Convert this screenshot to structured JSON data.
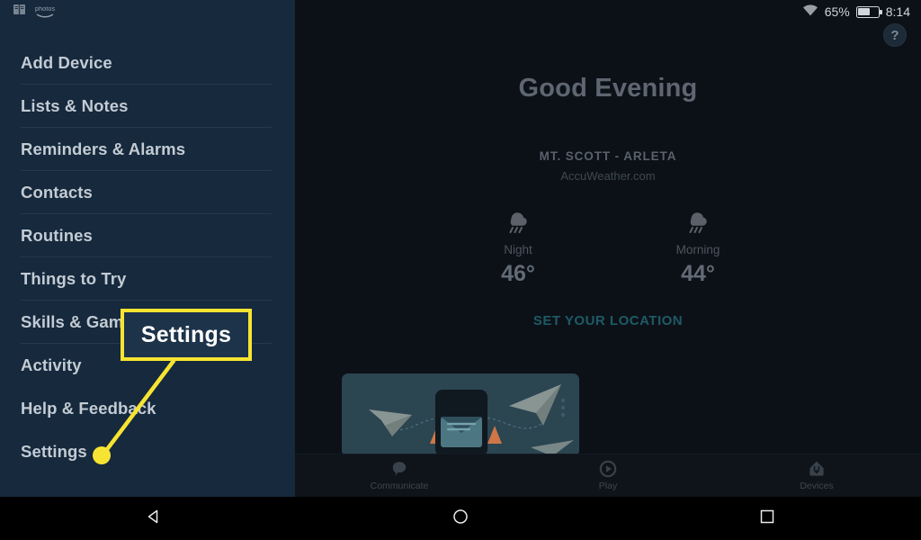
{
  "status_bar": {
    "notification_icons": [
      {
        "name": "book-icon",
        "label": "book"
      },
      {
        "name": "amazon-photos-icon",
        "label": "photos"
      }
    ],
    "wifi_icon": "wifi-icon",
    "battery_percent": "65%",
    "battery_icon": "battery-icon",
    "time": "8:14"
  },
  "sidebar": {
    "items": [
      {
        "label": "Add Device",
        "name": "sidebar-item-add-device",
        "divider": true
      },
      {
        "label": "Lists & Notes",
        "name": "sidebar-item-lists-notes",
        "divider": true
      },
      {
        "label": "Reminders & Alarms",
        "name": "sidebar-item-reminders-alarms",
        "divider": true
      },
      {
        "label": "Contacts",
        "name": "sidebar-item-contacts",
        "divider": true
      },
      {
        "label": "Routines",
        "name": "sidebar-item-routines",
        "divider": true
      },
      {
        "label": "Things to Try",
        "name": "sidebar-item-things-to-try",
        "divider": true
      },
      {
        "label": "Skills & Games",
        "name": "sidebar-item-skills-games",
        "divider": true
      },
      {
        "label": "Activity",
        "name": "sidebar-item-activity",
        "divider": false
      },
      {
        "label": "Help & Feedback",
        "name": "sidebar-item-help-feedback",
        "divider": false
      },
      {
        "label": "Settings",
        "name": "sidebar-item-settings",
        "divider": false
      }
    ]
  },
  "main": {
    "help_button": "?",
    "greeting": "Good Evening",
    "weather": {
      "city": "MT. SCOTT - ARLETA",
      "attribution": "AccuWeather.com",
      "forecasts": [
        {
          "when": "Night",
          "temp": "46°",
          "icon": "rain-cloud-icon"
        },
        {
          "when": "Morning",
          "temp": "44°",
          "icon": "rain-cloud-icon"
        }
      ],
      "set_location_label": "SET YOUR LOCATION"
    }
  },
  "tab_bar": {
    "tabs": [
      {
        "label": "Communicate",
        "name": "tab-communicate",
        "icon": "speech-bubble-icon"
      },
      {
        "label": "Play",
        "name": "tab-play",
        "icon": "play-circle-icon"
      },
      {
        "label": "Devices",
        "name": "tab-devices",
        "icon": "home-devices-icon"
      }
    ]
  },
  "annotation": {
    "callout_label": "Settings",
    "border_color": "#f7e432",
    "box_fill": "#1d3349"
  },
  "android_nav": {
    "buttons": [
      {
        "name": "android-back-button",
        "icon": "back-triangle-icon"
      },
      {
        "name": "android-home-button",
        "icon": "home-circle-icon"
      },
      {
        "name": "android-recents-button",
        "icon": "recents-square-icon"
      }
    ]
  },
  "colors": {
    "sidebar_bg": "#16293d",
    "main_bg": "#0c1117",
    "accent_yellow": "#f7e432",
    "link_teal": "#1e5a66"
  }
}
